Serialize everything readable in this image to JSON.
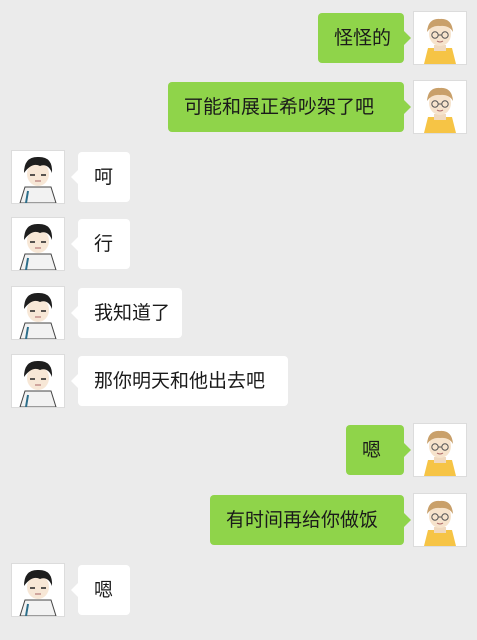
{
  "colors": {
    "background": "#ebebeb",
    "outgoing_bubble": "#8fd44a",
    "incoming_bubble": "#ffffff"
  },
  "messages": [
    {
      "side": "right",
      "text": "怪怪的",
      "avatar": "blond-boy-avatar"
    },
    {
      "side": "right",
      "text": "可能和展正希吵架了吧",
      "avatar": "blond-boy-avatar"
    },
    {
      "side": "left",
      "text": "呵",
      "avatar": "dark-hair-boy-avatar"
    },
    {
      "side": "left",
      "text": "行",
      "avatar": "dark-hair-boy-avatar"
    },
    {
      "side": "left",
      "text": "我知道了",
      "avatar": "dark-hair-boy-avatar"
    },
    {
      "side": "left",
      "text": "那你明天和他出去吧",
      "avatar": "dark-hair-boy-avatar"
    },
    {
      "side": "right",
      "text": "嗯",
      "avatar": "blond-boy-avatar"
    },
    {
      "side": "right",
      "text": "有时间再给你做饭",
      "avatar": "blond-boy-avatar"
    },
    {
      "side": "left",
      "text": "嗯",
      "avatar": "dark-hair-boy-avatar"
    }
  ]
}
